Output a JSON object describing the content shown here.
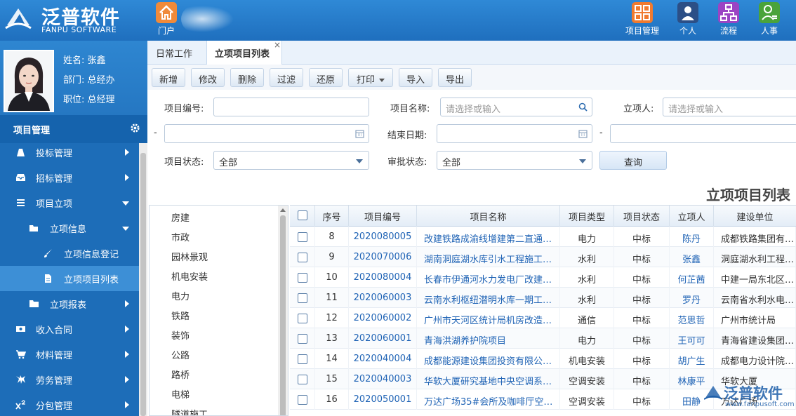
{
  "header": {
    "logo_cn": "泛普软件",
    "logo_en": "FANPU SOFTWARE",
    "portal_label": "门户",
    "nav": [
      {
        "label": "项目管理",
        "icon": "project-grid-icon",
        "color": "#f07a2e"
      },
      {
        "label": "个人",
        "icon": "person-icon",
        "color": "#2c4f86"
      },
      {
        "label": "流程",
        "icon": "flow-icon",
        "color": "#9b44c4"
      },
      {
        "label": "人事",
        "icon": "hr-person-icon",
        "color": "#4aa33b"
      }
    ]
  },
  "profile": {
    "name": "姓名: 张鑫",
    "dept": "部门: 总经办",
    "title": "职位: 总经理"
  },
  "sidebar": {
    "section_title": "项目管理",
    "items": [
      {
        "label": "投标管理",
        "icon": "bid-icon"
      },
      {
        "label": "招标管理",
        "icon": "inbox-icon"
      },
      {
        "label": "项目立项",
        "icon": "list-icon"
      },
      {
        "label": "立项信息",
        "icon": "folder-open-icon"
      },
      {
        "label": "立项信息登记",
        "icon": "brush-icon"
      },
      {
        "label": "立项项目列表",
        "icon": "document-icon"
      },
      {
        "label": "立项报表",
        "icon": "folder-icon"
      },
      {
        "label": "收入合同",
        "icon": "money-icon"
      },
      {
        "label": "材料管理",
        "icon": "cart-icon"
      },
      {
        "label": "劳务管理",
        "icon": "labor-icon"
      },
      {
        "label": "分包管理",
        "icon": "superscript-icon"
      }
    ]
  },
  "tabs": [
    {
      "label": "日常工作"
    },
    {
      "label": "立项项目列表",
      "close": "×"
    }
  ],
  "toolbar": {
    "add": "新增",
    "edit": "修改",
    "delete": "删除",
    "filter": "过滤",
    "restore": "还原",
    "print": "打印",
    "import": "导入",
    "export": "导出"
  },
  "form": {
    "project_no_label": "项目编号:",
    "project_no_value": "",
    "project_name_label": "项目名称:",
    "project_name_placeholder": "请选择或输入",
    "creator_label": "立项人:",
    "creator_placeholder": "请选择或输入",
    "dash": "-",
    "end_date_label": "结束日期:",
    "status_label": "项目状态:",
    "status_value": "全部",
    "approval_label": "审批状态:",
    "approval_value": "全部",
    "query_button": "查询"
  },
  "page_title": "立项项目列表",
  "tree": [
    "房建",
    "市政",
    "园林景观",
    "机电安装",
    "电力",
    "铁路",
    "装饰",
    "公路",
    "路桥",
    "电梯",
    "隧道施工"
  ],
  "table": {
    "columns": [
      "序号",
      "项目编号",
      "项目名称",
      "项目类型",
      "项目状态",
      "立项人",
      "建设单位"
    ],
    "rows": [
      {
        "seq": "8",
        "code": "2020080005",
        "name": "改建铁路成渝线增建第二直通…",
        "type": "电力",
        "status": "中标",
        "creator": "陈丹",
        "unit": "成都铁路集团有…"
      },
      {
        "seq": "9",
        "code": "2020070006",
        "name": "湖南洞庭湖水库引水工程施工…",
        "type": "水利",
        "status": "中标",
        "creator": "张鑫",
        "unit": "洞庭湖水利工程…"
      },
      {
        "seq": "10",
        "code": "2020080004",
        "name": "长春市伊通河水力发电厂改建…",
        "type": "水利",
        "status": "中标",
        "creator": "何芷茜",
        "unit": "中建一局东北区…"
      },
      {
        "seq": "11",
        "code": "2020060003",
        "name": "云南水利枢纽潜明水库一期工…",
        "type": "水利",
        "status": "中标",
        "creator": "罗丹",
        "unit": "云南省水利水电…"
      },
      {
        "seq": "12",
        "code": "2020060002",
        "name": "广州市天河区统计局机房改造…",
        "type": "通信",
        "status": "中标",
        "creator": "范思哲",
        "unit": "广州市统计局"
      },
      {
        "seq": "13",
        "code": "2020060001",
        "name": "青海洪湖养护院项目",
        "type": "电力",
        "status": "中标",
        "creator": "王可可",
        "unit": "青海省建设集团…"
      },
      {
        "seq": "14",
        "code": "2020040004",
        "name": "成都能源建设集团投资有限公…",
        "type": "机电安装",
        "status": "中标",
        "creator": "胡广生",
        "unit": "成都电力设计院…"
      },
      {
        "seq": "15",
        "code": "2020040003",
        "name": "华软大厦研究基地中央空调系…",
        "type": "空调安装",
        "status": "中标",
        "creator": "林康平",
        "unit": "华软大厦"
      },
      {
        "seq": "16",
        "code": "2020050001",
        "name": "万达广场35#会所及咖啡厅空…",
        "type": "空调安装",
        "status": "中标",
        "creator": "田静",
        "unit": "万达广场"
      }
    ]
  },
  "watermark": {
    "cn": "泛普软件",
    "url": "www.fanpusoft.com"
  }
}
